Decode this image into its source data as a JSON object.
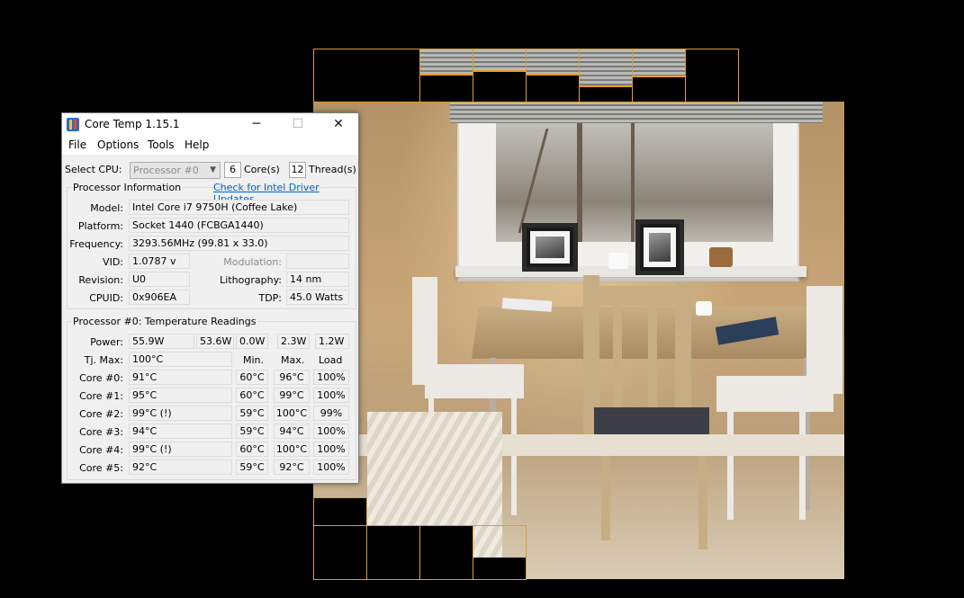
{
  "window": {
    "title": "Core Temp 1.15.1",
    "controls": {
      "minimize": "─",
      "maximize": "☐",
      "close": "✕"
    }
  },
  "menu": [
    "File",
    "Options",
    "Tools",
    "Help"
  ],
  "cpu_select": {
    "label": "Select CPU:",
    "selected": "Processor #0",
    "cores_value": "6",
    "cores_label": "Core(s)",
    "threads_value": "12",
    "threads_label": "Thread(s)"
  },
  "processor_info": {
    "title": "Processor Information",
    "driver_link": "Check for Intel Driver Updates",
    "model_label": "Model:",
    "model": "Intel Core i7 9750H (Coffee Lake)",
    "platform_label": "Platform:",
    "platform": "Socket 1440 (FCBGA1440)",
    "frequency_label": "Frequency:",
    "frequency": "3293.56MHz (99.81 x 33.0)",
    "vid_label": "VID:",
    "vid": "1.0787 v",
    "modulation_label": "Modulation:",
    "modulation": "",
    "revision_label": "Revision:",
    "revision": "U0",
    "lithography_label": "Lithography:",
    "lithography": "14 nm",
    "cpuid_label": "CPUID:",
    "cpuid": "0x906EA",
    "tdp_label": "TDP:",
    "tdp": "45.0 Watts"
  },
  "temps": {
    "title": "Processor #0: Temperature Readings",
    "power_label": "Power:",
    "power": [
      "55.9W",
      "53.6W",
      "0.0W",
      "2.3W",
      "1.2W"
    ],
    "tjmax_label": "Tj. Max:",
    "tjmax": "100°C",
    "col_min": "Min.",
    "col_max": "Max.",
    "col_load": "Load",
    "cores": [
      {
        "label": "Core #0:",
        "temp": "91°C",
        "min": "60°C",
        "max": "96°C",
        "load": "100%"
      },
      {
        "label": "Core #1:",
        "temp": "95°C",
        "min": "60°C",
        "max": "99°C",
        "load": "100%"
      },
      {
        "label": "Core #2:",
        "temp": "99°C (!)",
        "min": "59°C",
        "max": "100°C",
        "load": "99%"
      },
      {
        "label": "Core #3:",
        "temp": "94°C",
        "min": "59°C",
        "max": "94°C",
        "load": "100%"
      },
      {
        "label": "Core #4:",
        "temp": "99°C (!)",
        "min": "60°C",
        "max": "100°C",
        "load": "100%"
      },
      {
        "label": "Core #5:",
        "temp": "92°C",
        "min": "59°C",
        "max": "92°C",
        "load": "100%"
      }
    ]
  },
  "colors": {
    "tile_outline": "#e39b2c",
    "link": "#0066cc",
    "window_bg": "#f0f0f0"
  }
}
